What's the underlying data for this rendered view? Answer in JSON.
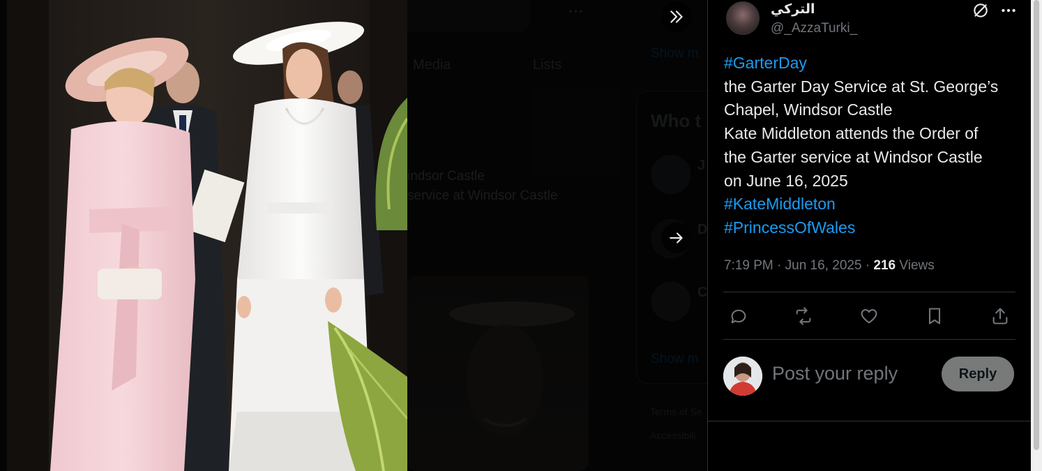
{
  "background_page": {
    "tabs": [
      "Media",
      "Lists"
    ],
    "snippets": [
      "indsor Castle",
      "service at Windsor Castle"
    ],
    "who_to_follow": "Who t",
    "show_more": "Show m",
    "footer_links": [
      "Terms of Se",
      "Accessibili"
    ],
    "initials": [
      "J",
      "D",
      "C"
    ]
  },
  "viewer": {
    "prev_icon": "double-chevron-icon",
    "next_icon": "arrow-right-icon"
  },
  "tweet": {
    "author_name": "التركي",
    "author_handle": "@_AzzaTurki_",
    "lines": [
      {
        "text": "#GarterDay",
        "hashtag": true
      },
      {
        "text": "the Garter Day Service at St. George’s",
        "hashtag": false
      },
      {
        "text": "Chapel, Windsor Castle",
        "hashtag": false
      },
      {
        "text": "Kate Middleton attends the Order of",
        "hashtag": false
      },
      {
        "text": "the Garter service at Windsor Castle",
        "hashtag": false
      },
      {
        "text": "on June 16, 2025",
        "hashtag": false
      },
      {
        "text": "#KateMiddleton",
        "hashtag": true
      },
      {
        "text": "#PrincessOfWales",
        "hashtag": true
      }
    ],
    "timestamp": "7:19 PM · Jun 16, 2025 · ",
    "views_count": "216",
    "views_label": " Views",
    "actions": [
      "reply-icon",
      "retweet-icon",
      "like-icon",
      "bookmark-icon",
      "share-icon"
    ]
  },
  "composer": {
    "placeholder": "Post your reply",
    "reply_label": "Reply"
  },
  "colors": {
    "accent": "#1d9bf0",
    "muted": "#71767b",
    "text": "#e7e9ea",
    "border": "#2f3336",
    "reply_button": "#787a7a"
  }
}
